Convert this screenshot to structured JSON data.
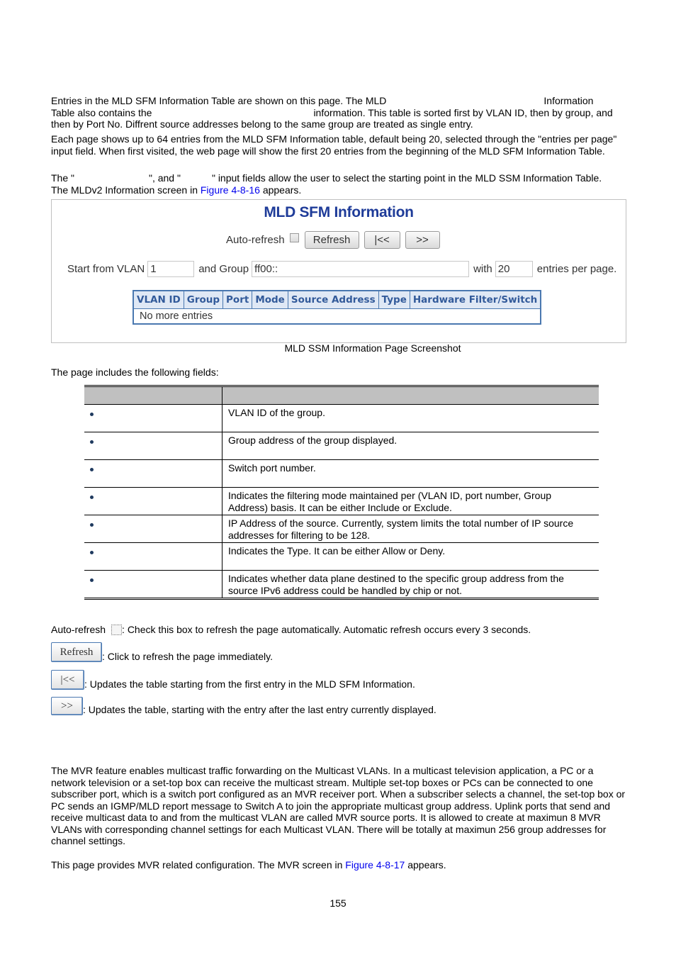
{
  "intro": {
    "p1_part1": "Entries in the MLD SFM Information Table are shown on this page. The MLD",
    "p1_part2": "Information",
    "p1_part3": "Table also contains the",
    "p1_part4": "information. This table is sorted first by VLAN ID, then by group, and",
    "p1_part5": "then by Port No. Diffrent source addresses belong to the same group are treated as single entry.",
    "p2": "Each page shows up to 64 entries from the MLD SFM Information table, default being 20, selected through the \"entries per page\" input field. When first visited, the web page will show the first 20 entries from the beginning of the MLD SFM Information Table.",
    "p3_part1": "The \"",
    "p3_part2": "\", and \"",
    "p3_part3": "\" input fields allow the user to select the starting point in the MLD SSM Information Table.",
    "p4_part1": "The MLDv2 Information screen in",
    "p4_link": "Figure 4-8-16",
    "p4_part2": "appears."
  },
  "figure": {
    "title": "MLD SFM Information",
    "auto_refresh_label": "Auto-refresh",
    "auto_refresh_checked": false,
    "refresh_button": "Refresh",
    "first_button": "|<<",
    "next_button": ">>",
    "start_vlan_label": "Start from VLAN",
    "start_vlan_value": "1",
    "group_label": "and Group",
    "group_value": "ff00::",
    "with_label": "with",
    "entries_value": "20",
    "entries_label": "entries per page.",
    "table": {
      "columns": [
        "VLAN ID",
        "Group",
        "Port",
        "Mode",
        "Source Address",
        "Type",
        "Hardware Filter/Switch"
      ],
      "empty_message": "No more entries"
    },
    "caption": "MLD SSM Information Page Screenshot"
  },
  "fields_intro": "The page includes the following fields:",
  "fields_table": {
    "header": [
      "",
      ""
    ],
    "rows": [
      {
        "object": "",
        "description": "VLAN ID of the group."
      },
      {
        "object": "",
        "description": "Group address of the group displayed."
      },
      {
        "object": "",
        "description": "Switch port number."
      },
      {
        "object": "",
        "description": "Indicates the filtering mode maintained per (VLAN ID, port number, Group Address) basis. It can be either Include or Exclude."
      },
      {
        "object": "",
        "description": "IP Address of the source. Currently, system limits the total number of IP source addresses for filtering to be 128."
      },
      {
        "object": "",
        "description": "Indicates the Type. It can be either Allow or Deny."
      },
      {
        "object": "",
        "description": "Indicates whether data plane destined to the specific group address from the source IPv6 address could be handled by chip or not."
      }
    ]
  },
  "buttons_desc": {
    "auto_refresh_label": "Auto-refresh",
    "auto_refresh_text": ": Check this box to refresh the page automatically. Automatic refresh occurs every 3 seconds.",
    "refresh_label": "Refresh",
    "refresh_text": ": Click to refresh the page immediately.",
    "first_label": "|<<",
    "first_text": ": Updates the table starting from the first entry in the MLD SFM Information.",
    "next_label": ">>",
    "next_text": ": Updates the table, starting with the entry after the last entry currently displayed."
  },
  "mvr": {
    "p1": "The MVR feature enables multicast traffic forwarding on the Multicast VLANs. In a multicast television application, a PC or a network television or a set-top box can receive the multicast stream. Multiple set-top boxes or PCs can be connected to one subscriber port, which is a switch port configured as an MVR receiver port. When a subscriber selects a channel, the set-top box or PC sends an IGMP/MLD report message to Switch A to join the appropriate multicast group address. Uplink ports that send and receive multicast data to and from the multicast VLAN are called MVR source ports. It is allowed to create at maximun 8 MVR VLANs with corresponding channel settings for each Multicast VLAN. There will be totally at maximun 256 group addresses for channel settings.",
    "p2_part1": "This page provides MVR related configuration. The MVR screen in",
    "p2_link": "Figure 4-8-17",
    "p2_part2": "appears."
  },
  "page_number": "155"
}
